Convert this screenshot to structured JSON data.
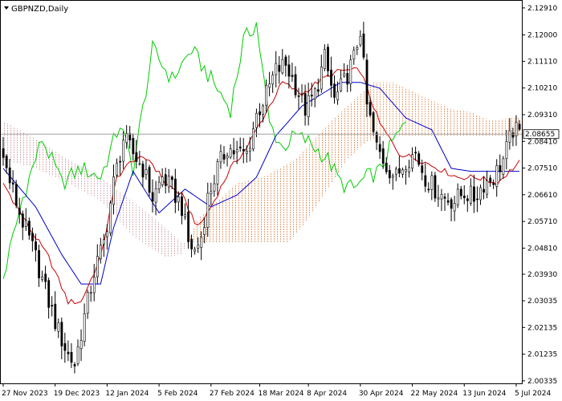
{
  "chart_data": {
    "type": "candlestick",
    "title": "GBPNZD,Daily",
    "symbol": "GBPNZD",
    "timeframe": "Daily",
    "current_price": 2.08655,
    "current_price_label": "2.08655",
    "y_ticks": [
      {
        "value": 2.1291,
        "label": "2.12910"
      },
      {
        "value": 2.12,
        "label": "2.12000"
      },
      {
        "value": 2.1111,
        "label": "2.11110"
      },
      {
        "value": 2.1021,
        "label": "2.10210"
      },
      {
        "value": 2.0931,
        "label": "2.09310"
      },
      {
        "value": 2.0841,
        "label": "2.08410"
      },
      {
        "value": 2.0751,
        "label": "2.07510"
      },
      {
        "value": 2.0661,
        "label": "2.06610"
      },
      {
        "value": 2.0571,
        "label": "2.05710"
      },
      {
        "value": 2.0481,
        "label": "2.04810"
      },
      {
        "value": 2.0393,
        "label": "2.03930"
      },
      {
        "value": 2.03035,
        "label": "2.03035"
      },
      {
        "value": 2.02135,
        "label": "2.02135"
      },
      {
        "value": 2.01235,
        "label": "2.01235"
      },
      {
        "value": 2.00335,
        "label": "2.00335"
      }
    ],
    "x_ticks": [
      {
        "index": 0,
        "label": "27 Nov 2023"
      },
      {
        "index": 16,
        "label": "19 Dec 2023"
      },
      {
        "index": 32,
        "label": "12 Jan 2024"
      },
      {
        "index": 48,
        "label": "5 Feb 2024"
      },
      {
        "index": 64,
        "label": "27 Feb 2024"
      },
      {
        "index": 79,
        "label": "18 Mar 2024"
      },
      {
        "index": 94,
        "label": "8 Apr 2024"
      },
      {
        "index": 110,
        "label": "30 Apr 2024"
      },
      {
        "index": 126,
        "label": "22 May 2024"
      },
      {
        "index": 142,
        "label": "13 Jun 2024"
      },
      {
        "index": 158,
        "label": "5 Jul 2024"
      }
    ],
    "ylim": [
      2.0025,
      2.1315
    ],
    "bar_count": 160,
    "close_anchors": [
      [
        0,
        2.078
      ],
      [
        5,
        2.06
      ],
      [
        10,
        2.045
      ],
      [
        14,
        2.03
      ],
      [
        17,
        2.02
      ],
      [
        20,
        2.012
      ],
      [
        22,
        2.009
      ],
      [
        25,
        2.025
      ],
      [
        28,
        2.04
      ],
      [
        31,
        2.05
      ],
      [
        34,
        2.07
      ],
      [
        37,
        2.085
      ],
      [
        40,
        2.08
      ],
      [
        43,
        2.075
      ],
      [
        46,
        2.065
      ],
      [
        49,
        2.072
      ],
      [
        52,
        2.068
      ],
      [
        55,
        2.062
      ],
      [
        57,
        2.05
      ],
      [
        59,
        2.047
      ],
      [
        61,
        2.052
      ],
      [
        63,
        2.065
      ],
      [
        66,
        2.075
      ],
      [
        69,
        2.082
      ],
      [
        72,
        2.08
      ],
      [
        75,
        2.08
      ],
      [
        78,
        2.093
      ],
      [
        81,
        2.1
      ],
      [
        84,
        2.108
      ],
      [
        87,
        2.11
      ],
      [
        90,
        2.103
      ],
      [
        93,
        2.095
      ],
      [
        96,
        2.1
      ],
      [
        99,
        2.112
      ],
      [
        102,
        2.098
      ],
      [
        105,
        2.104
      ],
      [
        108,
        2.112
      ],
      [
        110,
        2.122
      ],
      [
        112,
        2.096
      ],
      [
        115,
        2.082
      ],
      [
        118,
        2.076
      ],
      [
        121,
        2.072
      ],
      [
        124,
        2.078
      ],
      [
        127,
        2.08
      ],
      [
        130,
        2.072
      ],
      [
        133,
        2.068
      ],
      [
        136,
        2.065
      ],
      [
        139,
        2.064
      ],
      [
        142,
        2.067
      ],
      [
        145,
        2.065
      ],
      [
        148,
        2.07
      ],
      [
        151,
        2.072
      ],
      [
        154,
        2.078
      ],
      [
        157,
        2.088
      ],
      [
        159,
        2.0865
      ]
    ],
    "tenkan_anchors": [
      [
        0,
        2.07
      ],
      [
        8,
        2.055
      ],
      [
        14,
        2.045
      ],
      [
        20,
        2.03
      ],
      [
        24,
        2.03
      ],
      [
        30,
        2.045
      ],
      [
        35,
        2.072
      ],
      [
        40,
        2.078
      ],
      [
        45,
        2.078
      ],
      [
        50,
        2.07
      ],
      [
        55,
        2.066
      ],
      [
        60,
        2.055
      ],
      [
        64,
        2.062
      ],
      [
        70,
        2.075
      ],
      [
        75,
        2.082
      ],
      [
        80,
        2.092
      ],
      [
        86,
        2.104
      ],
      [
        92,
        2.1
      ],
      [
        98,
        2.105
      ],
      [
        104,
        2.108
      ],
      [
        110,
        2.108
      ],
      [
        116,
        2.09
      ],
      [
        122,
        2.08
      ],
      [
        128,
        2.078
      ],
      [
        134,
        2.075
      ],
      [
        140,
        2.072
      ],
      [
        146,
        2.072
      ],
      [
        152,
        2.07
      ],
      [
        156,
        2.074
      ],
      [
        159,
        2.077
      ]
    ],
    "kijun_anchors": [
      [
        0,
        2.075
      ],
      [
        10,
        2.062
      ],
      [
        18,
        2.046
      ],
      [
        24,
        2.036
      ],
      [
        30,
        2.036
      ],
      [
        34,
        2.055
      ],
      [
        40,
        2.074
      ],
      [
        48,
        2.06
      ],
      [
        56,
        2.068
      ],
      [
        64,
        2.062
      ],
      [
        72,
        2.066
      ],
      [
        78,
        2.072
      ],
      [
        84,
        2.086
      ],
      [
        92,
        2.096
      ],
      [
        98,
        2.1
      ],
      [
        104,
        2.104
      ],
      [
        110,
        2.104
      ],
      [
        116,
        2.102
      ],
      [
        124,
        2.092
      ],
      [
        132,
        2.088
      ],
      [
        138,
        2.075
      ],
      [
        144,
        2.074
      ],
      [
        150,
        2.074
      ],
      [
        154,
        2.074
      ],
      [
        159,
        2.074
      ]
    ],
    "chikou_anchors": [
      [
        0,
        2.038
      ],
      [
        6,
        2.065
      ],
      [
        12,
        2.085
      ],
      [
        18,
        2.07
      ],
      [
        24,
        2.075
      ],
      [
        30,
        2.072
      ],
      [
        36,
        2.09
      ],
      [
        40,
        2.075
      ],
      [
        46,
        2.115
      ],
      [
        52,
        2.105
      ],
      [
        58,
        2.115
      ],
      [
        64,
        2.105
      ],
      [
        70,
        2.095
      ],
      [
        74,
        2.118
      ],
      [
        78,
        2.124
      ],
      [
        82,
        2.09
      ],
      [
        86,
        2.082
      ],
      [
        90,
        2.086
      ],
      [
        94,
        2.084
      ],
      [
        100,
        2.078
      ],
      [
        104,
        2.07
      ],
      [
        108,
        2.068
      ],
      [
        112,
        2.072
      ],
      [
        116,
        2.074
      ],
      [
        120,
        2.084
      ],
      [
        124,
        2.09
      ]
    ],
    "span_a_anchors": [
      [
        0,
        2.078
      ],
      [
        10,
        2.075
      ],
      [
        20,
        2.07
      ],
      [
        30,
        2.064
      ],
      [
        40,
        2.052
      ],
      [
        50,
        2.045
      ],
      [
        55,
        2.046
      ],
      [
        60,
        2.058
      ],
      [
        66,
        2.064
      ],
      [
        72,
        2.07
      ],
      [
        80,
        2.072
      ],
      [
        90,
        2.078
      ],
      [
        96,
        2.085
      ],
      [
        102,
        2.092
      ],
      [
        108,
        2.098
      ],
      [
        114,
        2.104
      ],
      [
        120,
        2.104
      ],
      [
        126,
        2.101
      ],
      [
        132,
        2.098
      ],
      [
        138,
        2.095
      ],
      [
        144,
        2.094
      ],
      [
        150,
        2.091
      ],
      [
        156,
        2.092
      ],
      [
        159,
        2.092
      ]
    ],
    "span_b_anchors": [
      [
        0,
        2.091
      ],
      [
        10,
        2.085
      ],
      [
        20,
        2.078
      ],
      [
        30,
        2.072
      ],
      [
        40,
        2.064
      ],
      [
        50,
        2.055
      ],
      [
        55,
        2.05
      ],
      [
        60,
        2.05
      ],
      [
        66,
        2.05
      ],
      [
        72,
        2.05
      ],
      [
        80,
        2.05
      ],
      [
        88,
        2.05
      ],
      [
        94,
        2.058
      ],
      [
        100,
        2.068
      ],
      [
        106,
        2.078
      ],
      [
        112,
        2.084
      ],
      [
        118,
        2.086
      ],
      [
        124,
        2.086
      ],
      [
        130,
        2.086
      ],
      [
        136,
        2.086
      ],
      [
        142,
        2.086
      ],
      [
        150,
        2.086
      ],
      [
        159,
        2.086
      ]
    ],
    "colors": {
      "background": "#ffffff",
      "candles": "#000000",
      "tenkan": "#cc0000",
      "kijun": "#0000cc",
      "chikou": "#00cc00",
      "cloud_bullish": "#e8a070",
      "cloud_bearish": "#d8b0b8",
      "price_line": "#a0a0a0",
      "price_label_bg": "#ffffff"
    },
    "grid": false,
    "legend": "none"
  }
}
